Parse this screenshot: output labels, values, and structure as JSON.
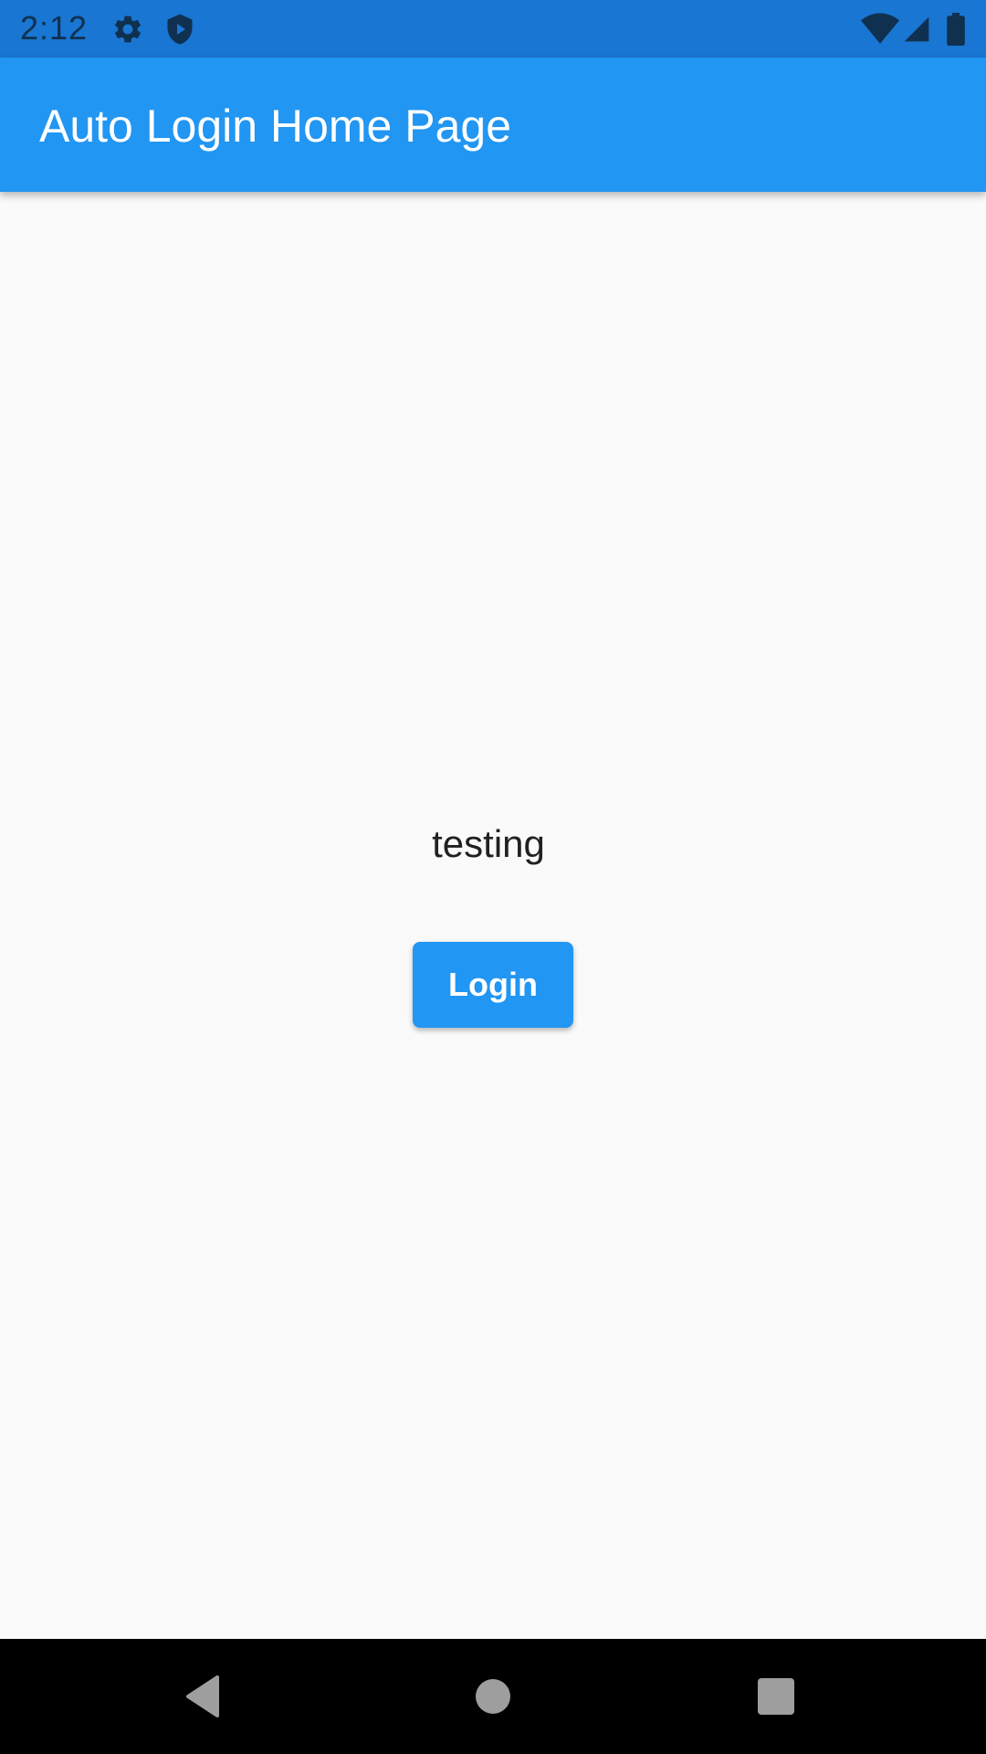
{
  "status_bar": {
    "time": "2:12",
    "icons": [
      "gear-icon",
      "shield-play-icon",
      "wifi-icon",
      "cell-signal-icon",
      "battery-icon"
    ]
  },
  "app_bar": {
    "title": "Auto Login Home Page"
  },
  "main": {
    "message": "testing",
    "login_label": "Login"
  },
  "nav_bar": {
    "icons": [
      "back-icon",
      "home-icon",
      "recents-icon"
    ]
  },
  "colors": {
    "status_bar": "#1976d2",
    "app_bar": "#2196f3",
    "background": "#fafafa",
    "button": "#2196f3",
    "nav_bar": "#000000"
  }
}
